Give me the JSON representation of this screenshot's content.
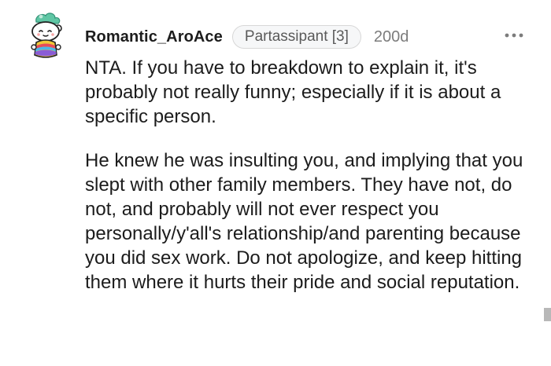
{
  "comment": {
    "author": "Romantic_AroAce",
    "flair": "Partassipant [3]",
    "age": "200d",
    "paragraphs": [
      "NTA. If you have to breakdown to explain it, it's probably not really funny; especially if it is about a specific person.",
      "He knew he was insulting you, and implying that you slept with other family members. They have not, do not, and probably will not ever respect you personally/y'all's relationship/and parenting because you did sex work. Do not apologize, and keep hitting them where it hurts their pride and social reputation."
    ]
  },
  "icons": {
    "avatar": "snoo-avatar-icon",
    "more": "more-options-icon"
  }
}
